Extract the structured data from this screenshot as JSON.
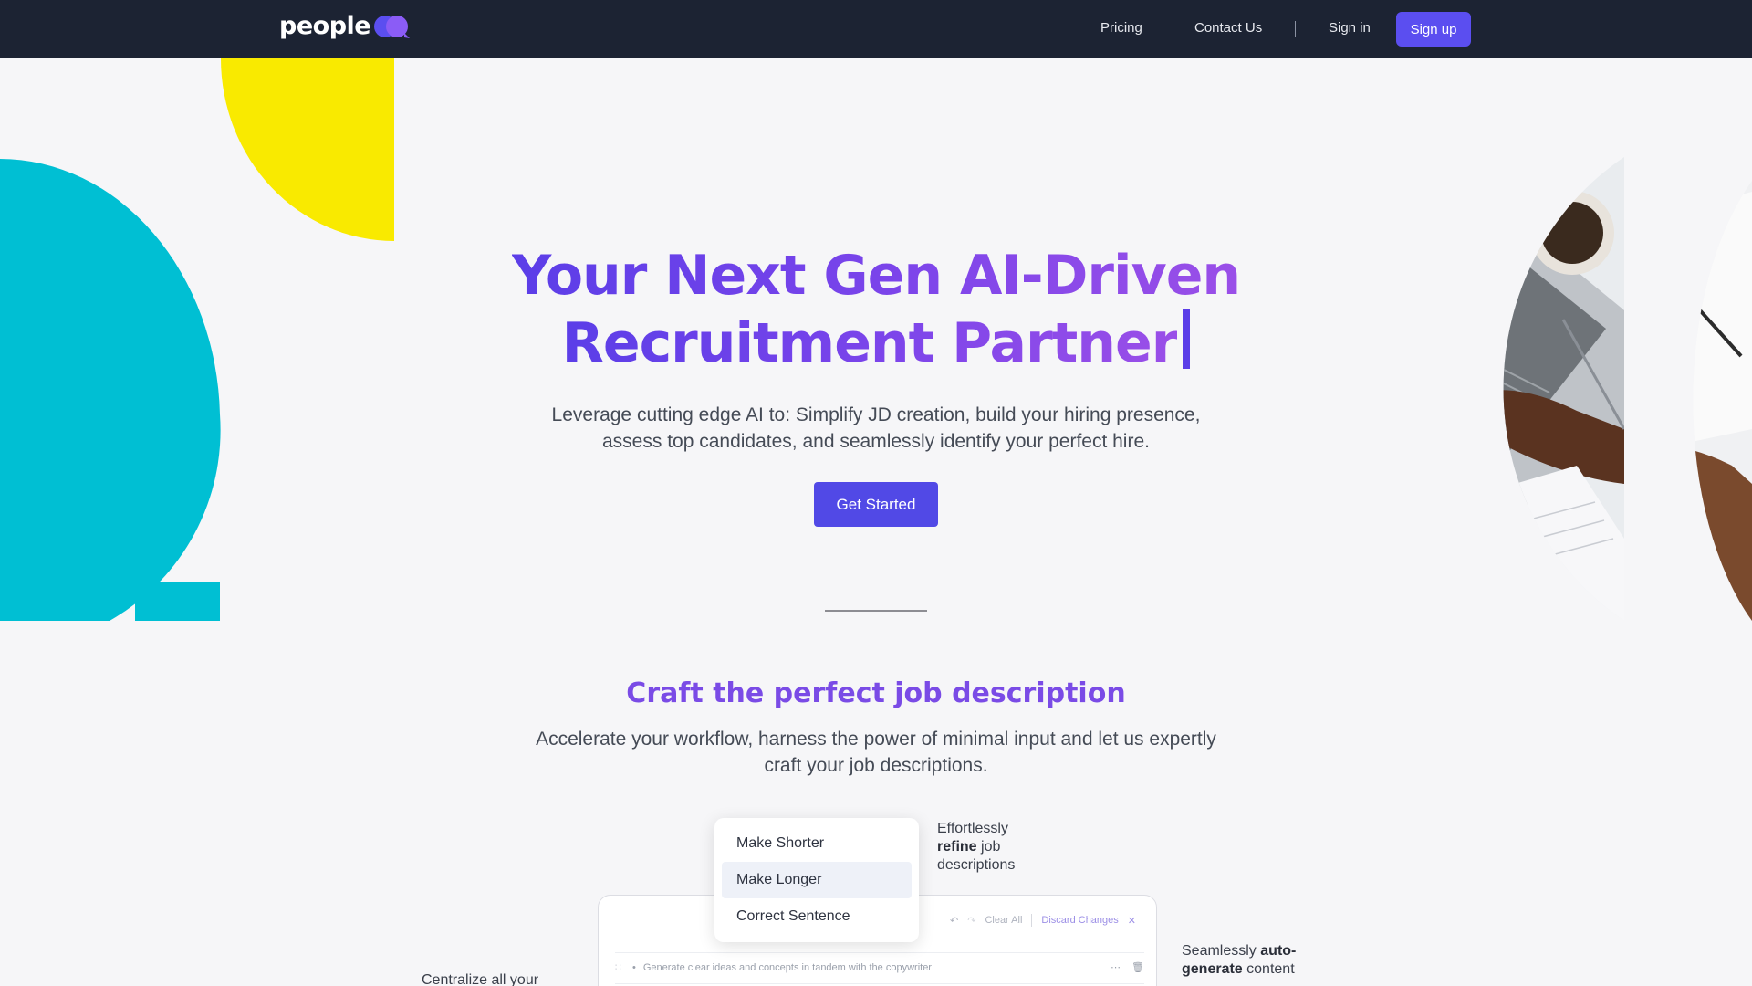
{
  "nav": {
    "logo_text": "people",
    "links": [
      {
        "label": "Pricing"
      },
      {
        "label": "Contact Us"
      },
      {
        "label": "Sign in"
      }
    ],
    "signup_label": "Sign up",
    "colors": {
      "bg": "#1c2333",
      "accent": "#5b4ef0"
    }
  },
  "hero": {
    "title_line1": "Your Next Gen AI-Driven",
    "title_line2": "Recruitment Partner",
    "subtitle_line1": "Leverage cutting edge AI to: Simplify JD creation, build your hiring presence,",
    "subtitle_line2": "assess top candidates, and seamlessly identify your perfect hire.",
    "cta_label": "Get Started",
    "colors": {
      "cyan": "#00bfd3",
      "yellow": "#f9ea00",
      "title_gradient_start": "#5b3ee8",
      "title_gradient_end": "#9a4fe8"
    }
  },
  "section": {
    "title": "Craft the perfect job description",
    "subtitle_line1": "Accelerate your workflow, harness the power of minimal input and let us expertly",
    "subtitle_line2": "craft your job descriptions."
  },
  "editor": {
    "clear_all": "Clear All",
    "discard": "Discard Changes",
    "row1_text": "Generate clear ideas and concepts in tandem with the copywriter"
  },
  "menu": {
    "items": [
      {
        "label": "Make Shorter"
      },
      {
        "label": "Make Longer"
      },
      {
        "label": "Correct Sentence"
      }
    ]
  },
  "notes": {
    "refine_pre": "Effortlessly",
    "refine_bold": "refine",
    "refine_post1": "job",
    "refine_post2": "descriptions",
    "auto_pre": "Seamlessly",
    "auto_bold1": "auto-",
    "auto_bold2": "generate",
    "auto_post": "content",
    "centralize": "Centralize all your"
  }
}
